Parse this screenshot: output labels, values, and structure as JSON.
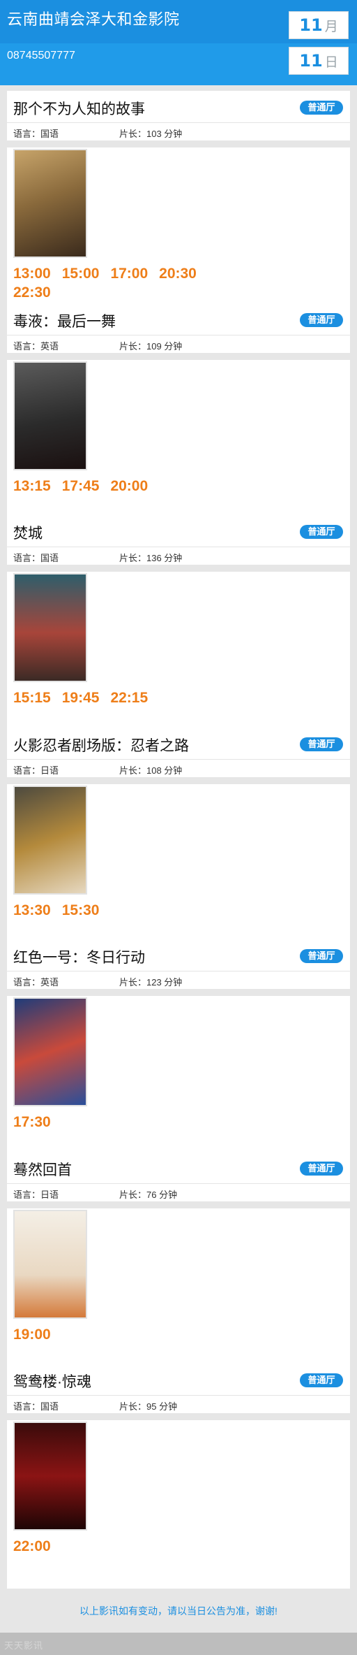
{
  "header": {
    "cinema_name": "云南曲靖会泽大和金影院",
    "phone": "08745507777",
    "month_num": "11",
    "month_unit": "月",
    "day_num": "11",
    "day_unit": "日"
  },
  "colors": {
    "header_blue": "#1b8fe0",
    "time_orange": "#ee7e19",
    "badge_blue": "#1b8fe0"
  },
  "movies": [
    {
      "title": "那个不为人知的故事",
      "hall": "普通厅",
      "language": "语言：国语",
      "duration": "片长：103 分钟",
      "times": [
        "13:00",
        "15:00",
        "17:00",
        "20:30",
        "22:30"
      ],
      "poster_icon": "movie-poster"
    },
    {
      "title": "毒液：最后一舞",
      "hall": "普通厅",
      "language": "语言：英语",
      "duration": "片长：109 分钟",
      "times": [
        "13:15",
        "17:45",
        "20:00"
      ],
      "poster_icon": "movie-poster"
    },
    {
      "title": "焚城",
      "hall": "普通厅",
      "language": "语言：国语",
      "duration": "片长：136 分钟",
      "times": [
        "15:15",
        "19:45",
        "22:15"
      ],
      "poster_icon": "movie-poster"
    },
    {
      "title": "火影忍者剧场版：忍者之路",
      "hall": "普通厅",
      "language": "语言：日语",
      "duration": "片长：108 分钟",
      "times": [
        "13:30",
        "15:30"
      ],
      "poster_icon": "movie-poster"
    },
    {
      "title": "红色一号：冬日行动",
      "hall": "普通厅",
      "language": "语言：英语",
      "duration": "片长：123 分钟",
      "times": [
        "17:30"
      ],
      "poster_icon": "movie-poster"
    },
    {
      "title": "蓦然回首",
      "hall": "普通厅",
      "language": "语言：日语",
      "duration": "片长：76 分钟",
      "times": [
        "19:00"
      ],
      "poster_icon": "movie-poster"
    },
    {
      "title": "鸳鸯楼·惊魂",
      "hall": "普通厅",
      "language": "语言：国语",
      "duration": "片长：95 分钟",
      "times": [
        "22:00"
      ],
      "poster_icon": "movie-poster"
    }
  ],
  "footer": {
    "notice": "以上影讯如有变动，请以当日公告为准，谢谢!",
    "watermark": "天天影讯"
  }
}
